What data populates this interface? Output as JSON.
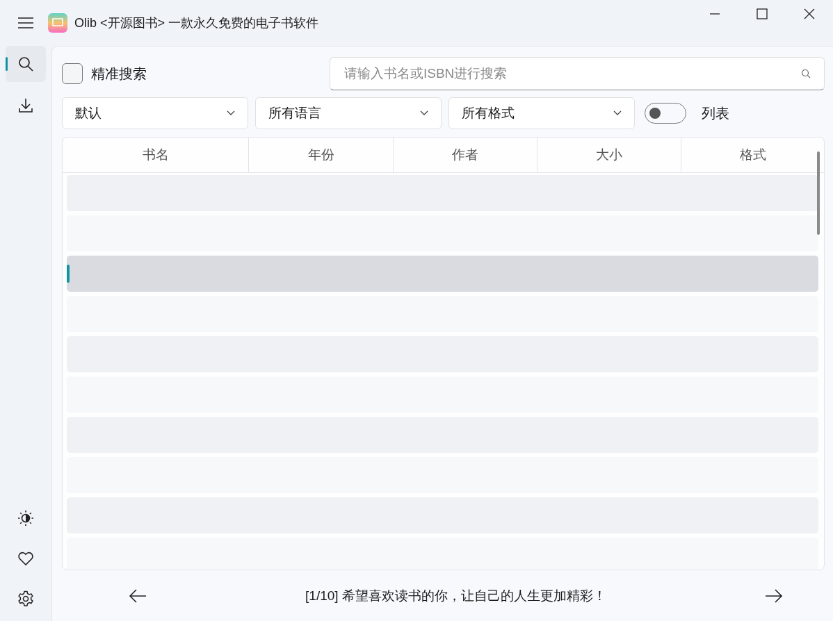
{
  "window": {
    "title": "Olib <开源图书> 一款永久免费的电子书软件"
  },
  "sidebar": {
    "items": [
      {
        "kind": "search",
        "selected": true
      },
      {
        "kind": "download",
        "selected": false
      }
    ],
    "bottom_items": [
      {
        "kind": "theme"
      },
      {
        "kind": "heart"
      },
      {
        "kind": "settings"
      }
    ]
  },
  "search": {
    "exact_label": "精准搜索",
    "exact_checked": false,
    "placeholder": "请输入书名或ISBN进行搜索"
  },
  "filters": [
    {
      "value": "默认"
    },
    {
      "value": "所有语言"
    },
    {
      "value": "所有格式"
    }
  ],
  "list_toggle": {
    "label": "列表",
    "on": false
  },
  "table": {
    "columns": [
      "书名",
      "年份",
      "作者",
      "大小",
      "格式"
    ],
    "rows": [
      {
        "selected": false
      },
      {
        "selected": false
      },
      {
        "selected": true
      },
      {
        "selected": false
      },
      {
        "selected": false
      },
      {
        "selected": false
      },
      {
        "selected": false
      },
      {
        "selected": false
      },
      {
        "selected": false
      },
      {
        "selected": false
      }
    ]
  },
  "footer": {
    "message": "[1/10] 希望喜欢读书的你，让自己的人生更加精彩！"
  }
}
